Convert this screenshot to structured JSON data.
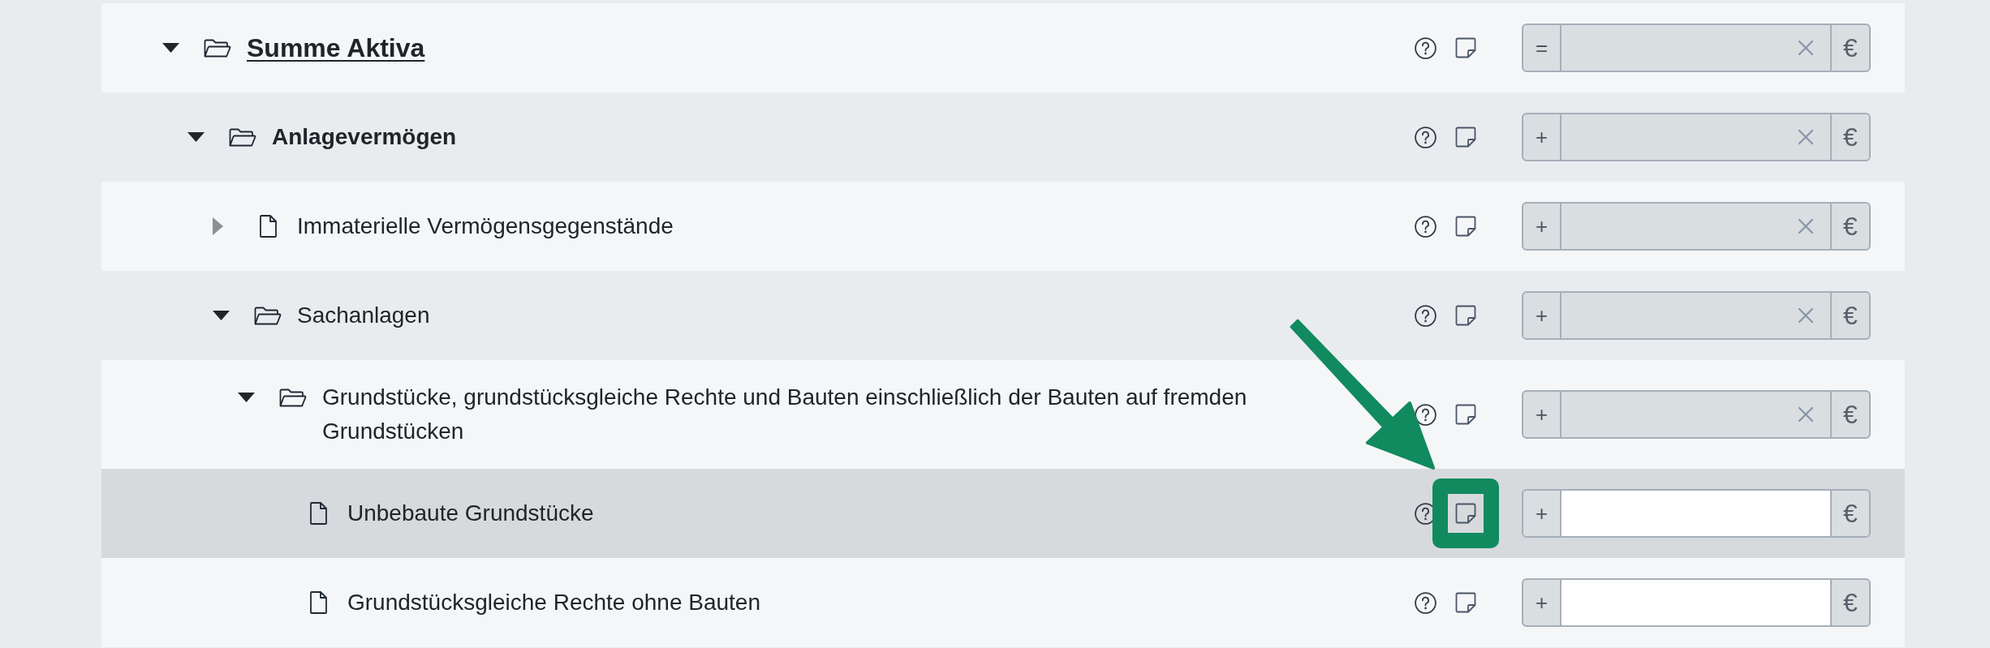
{
  "tree": [
    {
      "label": "Summe Aktiva",
      "kind": "folder",
      "expanded": true,
      "selected": false,
      "callout": false,
      "amount": {
        "operator": "=",
        "disabled": true,
        "clearable": true,
        "currency": "€"
      },
      "children": [
        {
          "label": "Anlagevermögen",
          "kind": "folder",
          "expanded": true,
          "selected": false,
          "callout": false,
          "amount": {
            "operator": "+",
            "disabled": true,
            "clearable": true,
            "currency": "€"
          },
          "children": [
            {
              "label": "Immaterielle Vermögensgegenstände",
              "kind": "file",
              "expanded": false,
              "selected": false,
              "callout": false,
              "amount": {
                "operator": "+",
                "disabled": true,
                "clearable": true,
                "currency": "€"
              }
            },
            {
              "label": "Sachanlagen",
              "kind": "folder",
              "expanded": true,
              "selected": false,
              "callout": false,
              "amount": {
                "operator": "+",
                "disabled": true,
                "clearable": true,
                "currency": "€"
              },
              "children": [
                {
                  "label": "Grundstücke, grundstücksgleiche Rechte und Bauten einschließlich der Bauten auf fremden Grundstücken",
                  "kind": "folder",
                  "expanded": true,
                  "selected": false,
                  "callout": false,
                  "amount": {
                    "operator": "+",
                    "disabled": true,
                    "clearable": true,
                    "currency": "€"
                  },
                  "children": [
                    {
                      "label": "Unbebaute Grundstücke",
                      "kind": "file",
                      "selected": true,
                      "callout": true,
                      "amount": {
                        "operator": "+",
                        "disabled": false,
                        "clearable": false,
                        "currency": "€"
                      }
                    },
                    {
                      "label": "Grundstücksgleiche Rechte ohne Bauten",
                      "kind": "file",
                      "selected": false,
                      "callout": false,
                      "amount": {
                        "operator": "+",
                        "disabled": false,
                        "clearable": false,
                        "currency": "€"
                      }
                    }
                  ]
                }
              ]
            }
          ]
        }
      ]
    }
  ]
}
